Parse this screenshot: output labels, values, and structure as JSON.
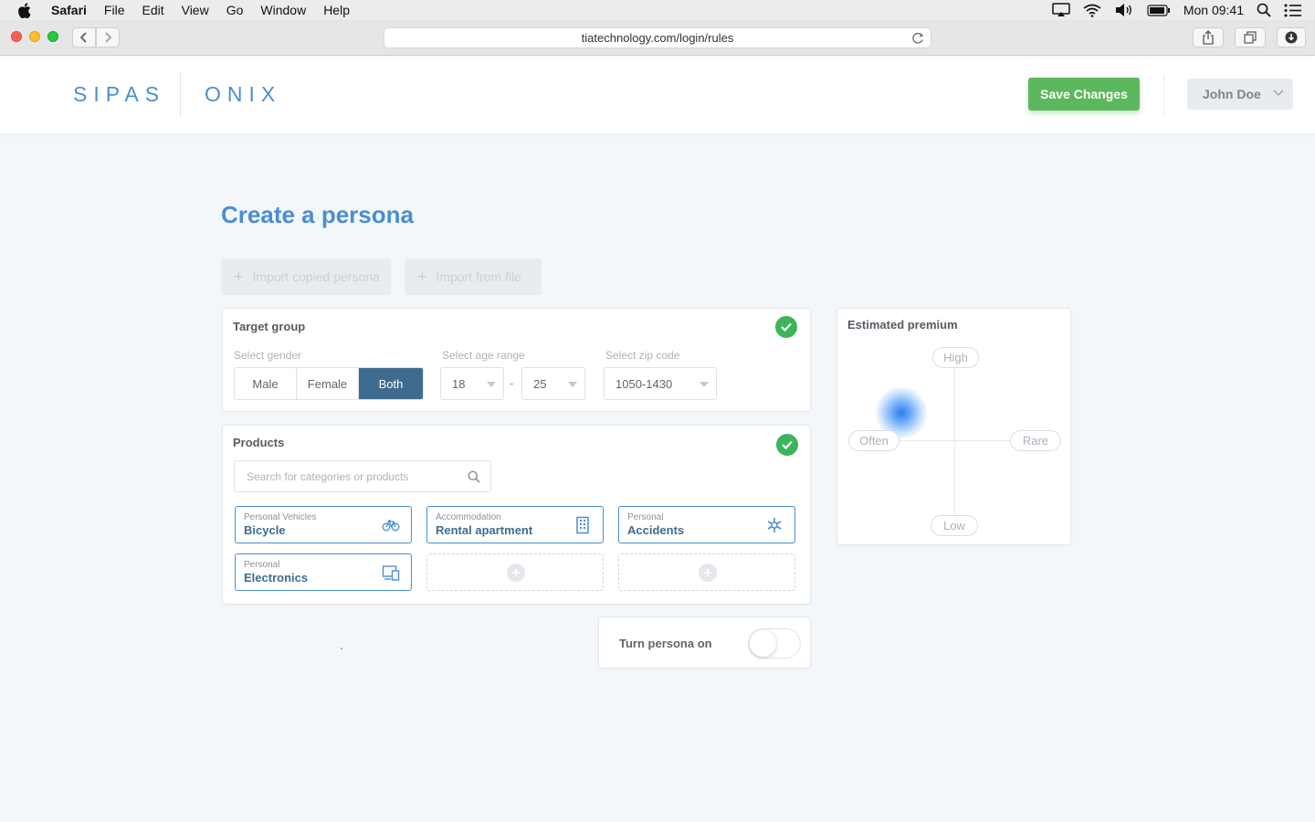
{
  "menubar": {
    "app_name": "Safari",
    "items": [
      "File",
      "Edit",
      "View",
      "Go",
      "Window",
      "Help"
    ],
    "clock": "Mon 09:41"
  },
  "browser": {
    "url": "tiatechnology.com/login/rules"
  },
  "header": {
    "logo_left": "SIPAS",
    "logo_right": "ONIX",
    "save_label": "Save Changes",
    "user_name": "John Doe"
  },
  "page": {
    "title": "Create a persona",
    "import_copied_label": "Import copied persona",
    "import_file_label": "Import from file"
  },
  "target_group": {
    "title": "Target group",
    "gender_label": "Select gender",
    "gender_options": [
      "Male",
      "Female",
      "Both"
    ],
    "gender_selected": "Both",
    "age_label": "Select age range",
    "age_min": "18",
    "age_separator": "-",
    "age_max": "25",
    "zip_label": "Select zip code",
    "zip_value": "1050-1430"
  },
  "products": {
    "title": "Products",
    "search_placeholder": "Search for categories or products",
    "tiles": [
      {
        "category": "Personal Vehicles",
        "name": "Bicycle",
        "icon": "bicycle-icon"
      },
      {
        "category": "Accommodation",
        "name": "Rental apartment",
        "icon": "building-icon"
      },
      {
        "category": "Personal",
        "name": "Accidents",
        "icon": "asterisk-icon"
      },
      {
        "category": "Personal",
        "name": "Electronics",
        "icon": "devices-icon"
      }
    ]
  },
  "toggle": {
    "label": "Turn persona on",
    "on": false
  },
  "premium": {
    "title": "Estimated premium",
    "high": "High",
    "low": "Low",
    "often": "Often",
    "rare": "Rare"
  },
  "colors": {
    "accent": "#4a8ed2",
    "save_green": "#5cb85c",
    "check_green": "#3cb45b",
    "segment_selected": "#3f6c8e"
  }
}
